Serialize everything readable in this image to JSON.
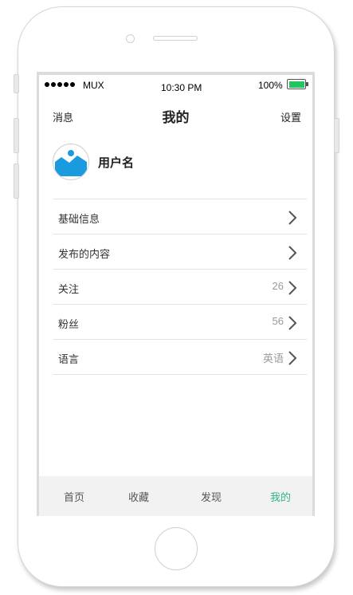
{
  "status_bar": {
    "carrier": "MUX",
    "time": "10:30 PM",
    "battery": "100%"
  },
  "nav": {
    "left": "消息",
    "title": "我的",
    "right": "设置"
  },
  "profile": {
    "username": "用户名"
  },
  "menu": [
    {
      "label": "基础信息",
      "value": ""
    },
    {
      "label": "发布的内容",
      "value": ""
    },
    {
      "label": "关注",
      "value": "26"
    },
    {
      "label": "粉丝",
      "value": "56"
    },
    {
      "label": "语言",
      "value": "英语"
    }
  ],
  "tabs": [
    {
      "label": "首页",
      "active": false
    },
    {
      "label": "收藏",
      "active": false
    },
    {
      "label": "发现",
      "active": false
    },
    {
      "label": "我的",
      "active": true
    }
  ],
  "colors": {
    "accent": "#2fb38c",
    "battery": "#22c55e",
    "avatar_blue": "#1a9be0"
  }
}
